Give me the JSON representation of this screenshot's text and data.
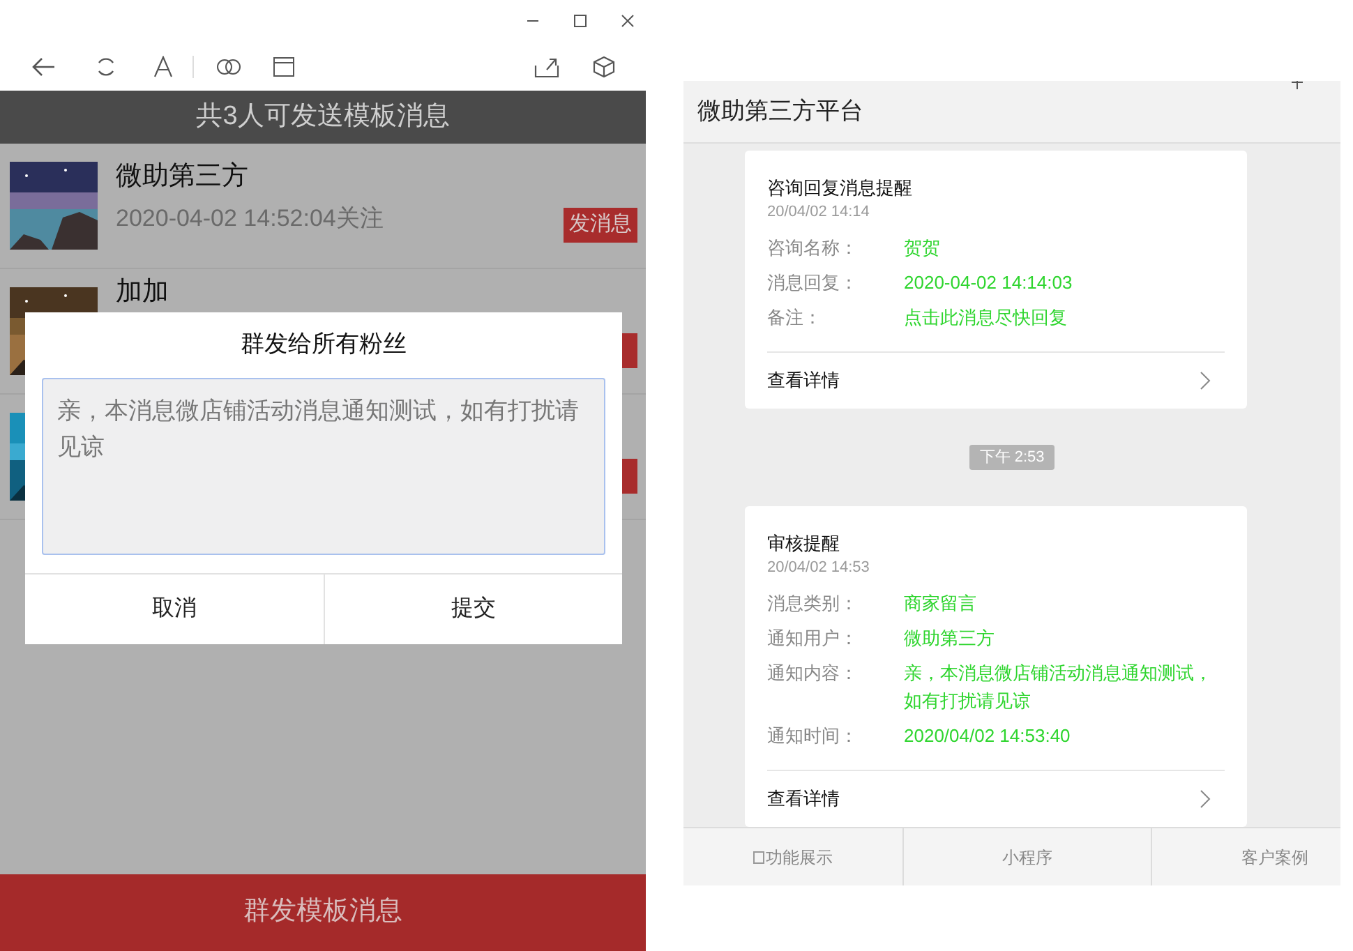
{
  "header": {
    "title": "共3人可发送模板消息"
  },
  "fans": [
    {
      "kind": "full",
      "name": "微助第三方",
      "followed": "2020-04-02 14:52:04关注",
      "send": "发消息"
    },
    {
      "kind": "covered",
      "name": "加加"
    },
    {
      "kind": "covered"
    }
  ],
  "dialog": {
    "title": "群发给所有粉丝",
    "message": "亲，本消息微店铺活动消息通知测试，如有打扰请见谅",
    "buttons": [
      "取消",
      "提交"
    ]
  },
  "bottom_button": "群发模板消息",
  "chat": {
    "title": "微助第三方平台",
    "messages": [
      {
        "kind": "card",
        "title": "咨询回复消息提醒",
        "time": "20/04/02 14:14",
        "fields": [
          {
            "label": "咨询名称：",
            "value": "贺贺"
          },
          {
            "label": "消息回复：",
            "value": "2020-04-02 14:14:03"
          },
          {
            "label": "备注：",
            "value": "点击此消息尽快回复"
          }
        ],
        "link": "查看详情"
      },
      {
        "kind": "time",
        "text": "下午 2:53"
      },
      {
        "kind": "card",
        "title": "审核提醒",
        "time": "20/04/02 14:53",
        "fields": [
          {
            "label": "消息类别：",
            "value": "商家留言"
          },
          {
            "label": "通知用户：",
            "value": "微助第三方"
          },
          {
            "label": "通知内容：",
            "value": "亲，本消息微店铺活动消息通知测试，如有打扰请见谅"
          },
          {
            "label": "通知时间：",
            "value": "2020/04/02 14:53:40"
          }
        ],
        "link": "查看详情"
      }
    ],
    "menu": [
      {
        "label": "功能展示",
        "icon": true
      },
      {
        "label": "小程序",
        "icon": false
      },
      {
        "label": "客户案例",
        "icon": false
      }
    ]
  }
}
